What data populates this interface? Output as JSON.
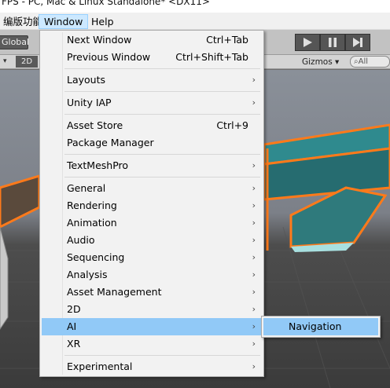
{
  "title": "FPS - PC, Mac & Linux Standalone* <DX11>",
  "menubar": {
    "items": [
      {
        "label": "编版功能"
      },
      {
        "label": "Window",
        "active": true
      },
      {
        "label": "Help"
      }
    ]
  },
  "toolbar": {
    "global_label": "Global",
    "play_buttons": [
      "play-icon",
      "pause-icon",
      "step-icon"
    ]
  },
  "scene_bar": {
    "mode_2d": "2D",
    "gizmos": "Gizmos",
    "search_placeholder": "All"
  },
  "window_menu": {
    "items": [
      {
        "label": "Next Window",
        "shortcut": "Ctrl+Tab"
      },
      {
        "label": "Previous Window",
        "shortcut": "Ctrl+Shift+Tab"
      },
      {
        "label": "Layouts",
        "submenu": true
      },
      {
        "label": "Unity IAP",
        "submenu": true
      },
      {
        "label": "Asset Store",
        "shortcut": "Ctrl+9"
      },
      {
        "label": "Package Manager"
      },
      {
        "label": "TextMeshPro",
        "submenu": true
      },
      {
        "label": "General",
        "submenu": true
      },
      {
        "label": "Rendering",
        "submenu": true
      },
      {
        "label": "Animation",
        "submenu": true
      },
      {
        "label": "Audio",
        "submenu": true
      },
      {
        "label": "Sequencing",
        "submenu": true
      },
      {
        "label": "Analysis",
        "submenu": true
      },
      {
        "label": "Asset Management",
        "submenu": true
      },
      {
        "label": "2D",
        "submenu": true
      },
      {
        "label": "AI",
        "submenu": true,
        "highlighted": true
      },
      {
        "label": "XR",
        "submenu": true
      },
      {
        "label": "Experimental",
        "submenu": true
      }
    ]
  },
  "ai_submenu": {
    "items": [
      {
        "label": "Navigation",
        "highlighted": true
      }
    ]
  },
  "colors": {
    "highlight": "#91c9f7",
    "menu_bg": "#f2f2f2",
    "scene_orange": "#ff7a1a",
    "scene_teal": "#2f8a8e"
  }
}
